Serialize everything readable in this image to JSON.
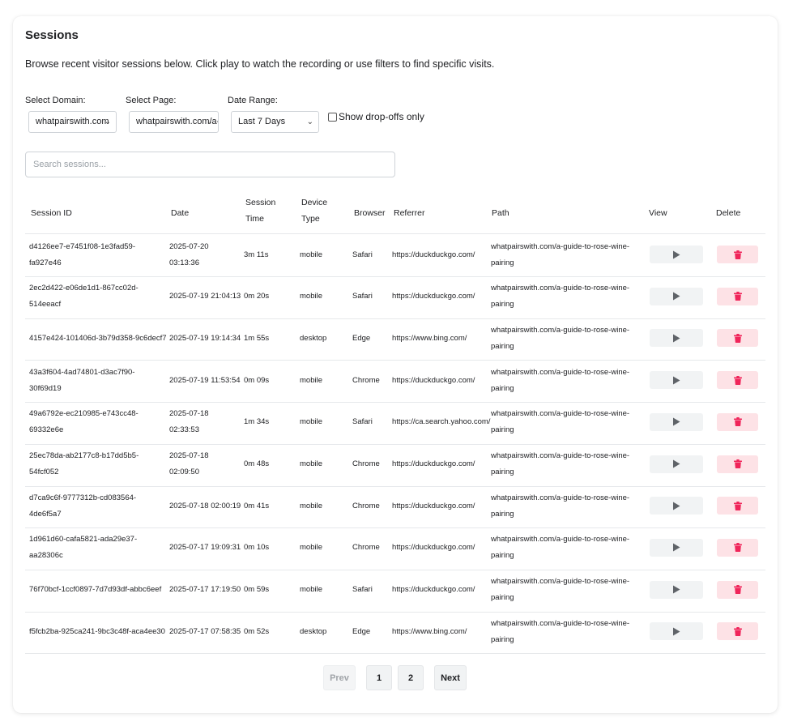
{
  "header": {
    "title": "Sessions",
    "description": "Browse recent visitor sessions below. Click play to watch the recording or use filters to find specific visits."
  },
  "filters": {
    "domain_label": "Select Domain:",
    "domain_value": "whatpairswith.com",
    "page_label": "Select Page:",
    "page_value": "whatpairswith.com/a-",
    "date_label": "Date Range:",
    "date_value": "Last 7 Days",
    "dropoffs_label": "Show drop-offs only"
  },
  "search": {
    "placeholder": "Search sessions..."
  },
  "table": {
    "headers": {
      "session_id": "Session ID",
      "date": "Date",
      "session_time_1": "Session",
      "session_time_2": "Time",
      "device_type_1": "Device",
      "device_type_2": "Type",
      "browser": "Browser",
      "referrer": "Referrer",
      "path": "Path",
      "view": "View",
      "delete": "Delete"
    },
    "rows": [
      {
        "id_1": "d4126ee7-e7451f08-1e3fad59-fa927e46",
        "id_2": "",
        "date_1": "2025-07-20",
        "date_2": "03:13:36",
        "time": "3m 11s",
        "device": "mobile",
        "browser": "Safari",
        "referrer": "https://duckduckgo.com/",
        "path_1": "whatpairswith.com/a-guide-to-rose-wine-",
        "path_2": "pairing"
      },
      {
        "id_1": "2ec2d422-e06de1d1-867cc02d-514eeacf",
        "id_2": "",
        "date_1": "2025-07-19 21:04:13",
        "date_2": "",
        "time": "0m 20s",
        "device": "mobile",
        "browser": "Safari",
        "referrer": "https://duckduckgo.com/",
        "path_1": "whatpairswith.com/a-guide-to-rose-wine-",
        "path_2": "pairing"
      },
      {
        "id_1": "4157e424-101406d-3b79d358-9c6decf7",
        "id_2": "",
        "date_1": "2025-07-19 19:14:34",
        "date_2": "",
        "time": "1m 55s",
        "device": "desktop",
        "browser": "Edge",
        "referrer": "https://www.bing.com/",
        "path_1": "whatpairswith.com/a-guide-to-rose-wine-",
        "path_2": "pairing"
      },
      {
        "id_1": "43a3f604-4ad74801-d3ac7f90-30f69d19",
        "id_2": "",
        "date_1": "2025-07-19 11:53:54",
        "date_2": "",
        "time": "0m 09s",
        "device": "mobile",
        "browser": "Chrome",
        "referrer": "https://duckduckgo.com/",
        "path_1": "whatpairswith.com/a-guide-to-rose-wine-",
        "path_2": "pairing"
      },
      {
        "id_1": "49a6792e-ec210985-e743cc48-",
        "id_2": "69332e6e",
        "date_1": "2025-07-18",
        "date_2": "02:33:53",
        "time": "1m 34s",
        "device": "mobile",
        "browser": "Safari",
        "referrer": "https://ca.search.yahoo.com/",
        "path_1": "whatpairswith.com/a-guide-to-rose-wine-",
        "path_2": "pairing"
      },
      {
        "id_1": "25ec78da-ab2177c8-b17dd5b5-54fcf052",
        "id_2": "",
        "date_1": "2025-07-18",
        "date_2": "02:09:50",
        "time": "0m 48s",
        "device": "mobile",
        "browser": "Chrome",
        "referrer": "https://duckduckgo.com/",
        "path_1": "whatpairswith.com/a-guide-to-rose-wine-",
        "path_2": "pairing"
      },
      {
        "id_1": "d7ca9c6f-9777312b-cd083564-4de6f5a7",
        "id_2": "",
        "date_1": "2025-07-18 02:00:19",
        "date_2": "",
        "time": "0m 41s",
        "device": "mobile",
        "browser": "Chrome",
        "referrer": "https://duckduckgo.com/",
        "path_1": "whatpairswith.com/a-guide-to-rose-wine-",
        "path_2": "pairing"
      },
      {
        "id_1": "1d961d60-cafa5821-ada29e37-aa28306c",
        "id_2": "",
        "date_1": "2025-07-17 19:09:31",
        "date_2": "",
        "time": "0m 10s",
        "device": "mobile",
        "browser": "Chrome",
        "referrer": "https://duckduckgo.com/",
        "path_1": "whatpairswith.com/a-guide-to-rose-wine-",
        "path_2": "pairing"
      },
      {
        "id_1": "76f70bcf-1ccf0897-7d7d93df-abbc6eef",
        "id_2": "",
        "date_1": "2025-07-17 17:19:50",
        "date_2": "",
        "time": "0m 59s",
        "device": "mobile",
        "browser": "Safari",
        "referrer": "https://duckduckgo.com/",
        "path_1": "whatpairswith.com/a-guide-to-rose-wine-",
        "path_2": "pairing"
      },
      {
        "id_1": "f5fcb2ba-925ca241-9bc3c48f-aca4ee30",
        "id_2": "",
        "date_1": "2025-07-17 07:58:35",
        "date_2": "",
        "time": "0m 52s",
        "device": "desktop",
        "browser": "Edge",
        "referrer": "https://www.bing.com/",
        "path_1": "whatpairswith.com/a-guide-to-rose-wine-",
        "path_2": "pairing"
      }
    ],
    "view_icon": "play-icon",
    "delete_icon": "trash-icon"
  },
  "pagination": {
    "prev": "Prev",
    "page1": "1",
    "page2": "2",
    "next": "Next"
  },
  "colors": {
    "delete_accent": "#f0255a",
    "delete_bg": "#fde2e6",
    "view_bg": "#f1f3f4",
    "play_icon": "#5f6368"
  }
}
